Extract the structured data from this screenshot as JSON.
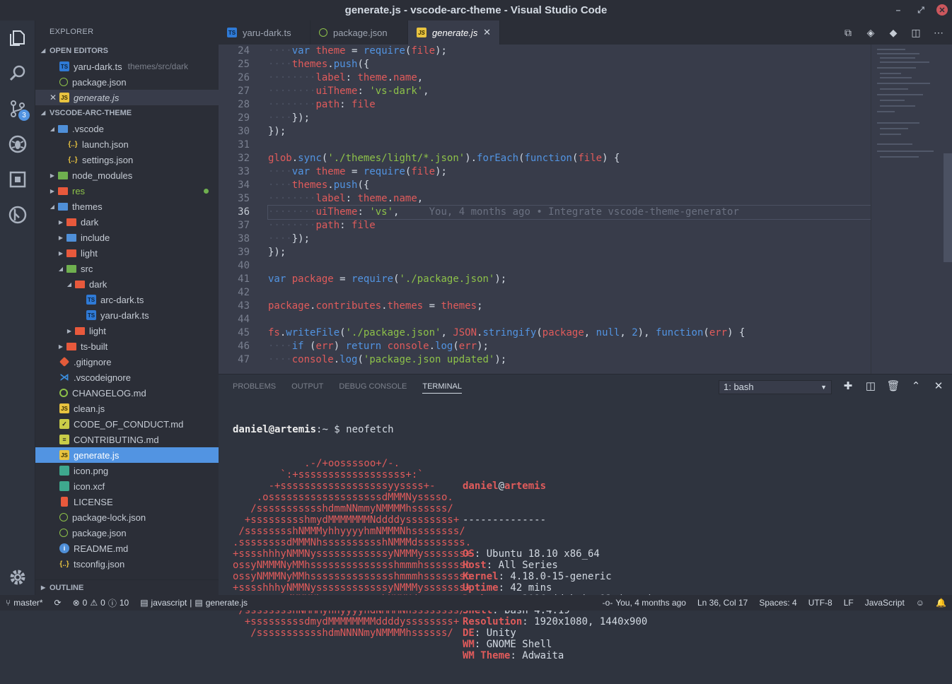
{
  "window": {
    "title": "generate.js - vscode-arc-theme - Visual Studio Code"
  },
  "activity": {
    "scm_badge": "3"
  },
  "sidebar": {
    "title": "EXPLORER",
    "open_editors_header": "OPEN EDITORS",
    "open_editors": [
      {
        "name": "yaru-dark.ts",
        "desc": "themes/src/dark"
      },
      {
        "name": "package.json",
        "desc": ""
      },
      {
        "name": "generate.js",
        "desc": ""
      }
    ],
    "project_header": "VSCODE-ARC-THEME",
    "tree": [
      ".vscode",
      "launch.json",
      "settings.json",
      "node_modules",
      "res",
      "themes",
      "dark",
      "include",
      "light",
      "src",
      "dark",
      "arc-dark.ts",
      "yaru-dark.ts",
      "light",
      "ts-built",
      ".gitignore",
      ".vscodeignore",
      "CHANGELOG.md",
      "clean.js",
      "CODE_OF_CONDUCT.md",
      "CONTRIBUTING.md",
      "generate.js",
      "icon.png",
      "icon.xcf",
      "LICENSE",
      "package-lock.json",
      "package.json",
      "README.md",
      "tsconfig.json"
    ],
    "outline_header": "OUTLINE"
  },
  "tabs": [
    {
      "label": "yaru-dark.ts",
      "icon": "ts"
    },
    {
      "label": "package.json",
      "icon": "json"
    },
    {
      "label": "generate.js",
      "icon": "js",
      "close": "✕"
    }
  ],
  "editor": {
    "line_numbers": [
      "24",
      "25",
      "26",
      "27",
      "28",
      "29",
      "30",
      "31",
      "32",
      "33",
      "34",
      "35",
      "36",
      "37",
      "38",
      "39",
      "40",
      "41",
      "42",
      "43",
      "44",
      "45",
      "46",
      "47"
    ],
    "blame": "You, 4 months ago • Integrate vscode-theme-generator"
  },
  "panel": {
    "tabs": [
      "PROBLEMS",
      "OUTPUT",
      "DEBUG CONSOLE",
      "TERMINAL"
    ],
    "terminal_select": "1: bash",
    "prompt_user": "daniel@artemis",
    "prompt_rest": ":~ $ neofetch",
    "ascii": [
      "            .-/+oossssoo+/-.",
      "        `:+ssssssssssssssssss+:`",
      "      -+ssssssssssssssssssyyssss+-",
      "    .osssssssssssssssssssdMMMNysssso.",
      "   /ssssssssssshdmmNNmmyNMMMMhssssss/",
      "  +ssssssssshmydMMMMMMMNddddyssssssss+",
      " /sssssssshNMMMyhhyyyyhmNMMMNhssssssss/",
      ".ssssssssdMMMNhsssssssssshNMMMdssssssss.",
      "+sssshhhyNMMNyssssssssssssyNMMMysssssss+",
      "ossyNMMMNyMMhsssssssssssssshmmmhssssssso",
      "ossyNMMMNyMMhsssssssssssssshmmmhssssssso",
      "+sssshhhyNMMNyssssssssssssyNMMMysssssss+",
      ".ssssssssdMMMNhsssssssssshNMMMdssssssss.",
      " /sssssssshNMMMyhhyyyyhdNMMMNhssssssss/",
      "  +sssssssssdmydMMMMMMMMddddyssssssss+",
      "   /ssssssssssshdmNNNNmyNMMMMhssssss/"
    ],
    "info_user": "daniel",
    "info_host": "artemis",
    "info_sep": "--------------",
    "info": [
      {
        "k": "OS",
        "v": "Ubuntu 18.10 x86_64"
      },
      {
        "k": "Host",
        "v": "All Series"
      },
      {
        "k": "Kernel",
        "v": "4.18.0-15-generic"
      },
      {
        "k": "Uptime",
        "v": "42 mins"
      },
      {
        "k": "Packages",
        "v": "3016 (dpkg), 13 (snap)"
      },
      {
        "k": "Shell",
        "v": "bash 4.4.19"
      },
      {
        "k": "Resolution",
        "v": "1920x1080, 1440x900"
      },
      {
        "k": "DE",
        "v": "Unity"
      },
      {
        "k": "WM",
        "v": "GNOME Shell"
      },
      {
        "k": "WM Theme",
        "v": "Adwaita"
      }
    ]
  },
  "status": {
    "branch": "master*",
    "errors": "0",
    "warnings": "0",
    "infos": "10",
    "breadcrumb_lang": "javascript",
    "breadcrumb_file": "generate.js",
    "blame": "You, 4 months ago",
    "position": "Ln 36, Col 17",
    "spaces": "Spaces: 4",
    "encoding": "UTF-8",
    "eol": "LF",
    "language": "JavaScript"
  },
  "colors": {
    "accent": "#5294e2",
    "red": "#e05b5b",
    "green": "#8dc149"
  }
}
